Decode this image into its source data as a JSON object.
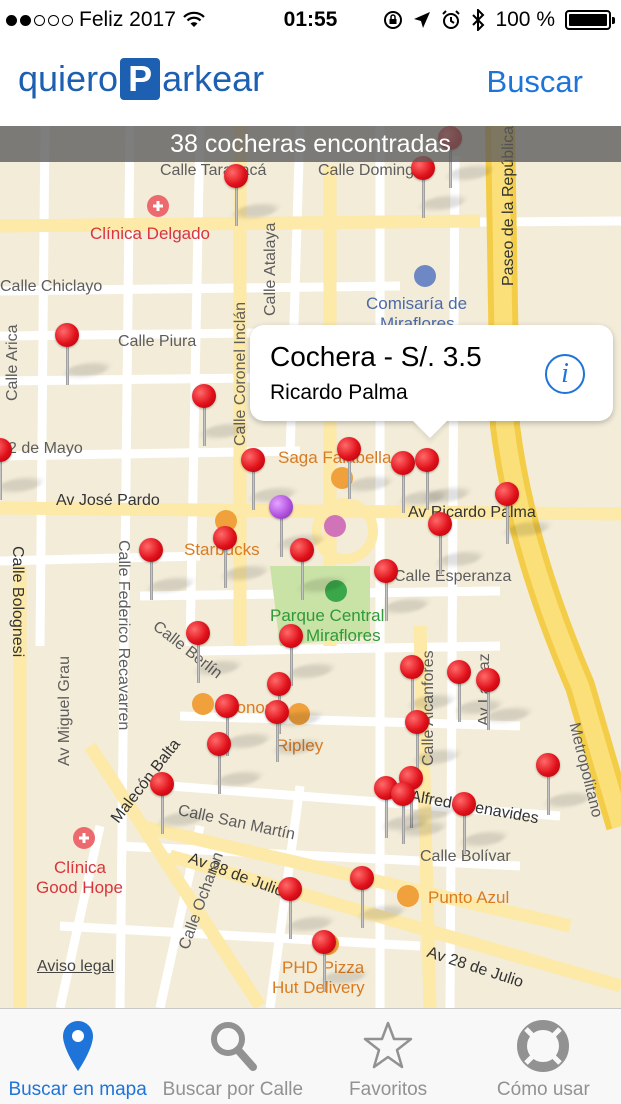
{
  "status_bar": {
    "carrier": "Feliz 2017",
    "time": "01:55",
    "battery": "100 %",
    "signal_icon": "signal-dots-icon",
    "wifi_icon": "wifi-icon",
    "lock_icon": "rotation-lock-icon",
    "location_icon": "location-arrow-icon",
    "alarm_icon": "alarm-icon",
    "bluetooth_icon": "bluetooth-icon"
  },
  "nav": {
    "logo_left": "quiero",
    "logo_p": "P",
    "logo_right": "arkear",
    "search_button": "Buscar"
  },
  "map": {
    "banner": "38 cocheras encontradas",
    "legal": "Aviso legal",
    "labels": {
      "calle_tarapaca": "Calle Tarapacá",
      "calle_domingo": "Calle Domingo",
      "clinica_delgado": "Clínica Delgado",
      "calle_chiclayo": "Calle Chiclayo",
      "calle_piura": "Calle Piura",
      "comisaria": "Comisaría de",
      "comisaria_2": "Miraflores",
      "paseo_republica": "Paseo de la República",
      "calle_arica": "Calle Arica",
      "calle_atalaya": "Calle Atalaya",
      "calle_coronel": "Calle Coronel Inclán",
      "dos_mayo": "2 de Mayo",
      "saga": "Saga Falabella",
      "av_jose_pardo": "Av José Pardo",
      "av_ricardo_palma": "Av Ricardo Palma",
      "starbucks": "Starbucks",
      "calle_esperanza": "Calle Esperanza",
      "calle_bolognesi": "Calle Bolognesi",
      "calle_federico": "Calle Federico Recavarren",
      "parque_1": "Parque Central",
      "parque_2": "Miraflores",
      "calle_berlin": "Calle Berlín",
      "av_miguel_grau": "Av Miguel Grau",
      "calle_alcanfores": "Calle Alcanfores",
      "av_la_paz": "Av La Paz",
      "tonos": "Tonos",
      "ripley": "Ripley",
      "malecon_balta": "Malecón Balta",
      "metropolitano": "Metropolitano",
      "alfredo_benavides": "Alfredo Benavides",
      "calle_san_martin": "Calle San Martín",
      "calle_bolivar": "Calle Bolívar",
      "clinica_gh_1": "Clínica",
      "clinica_gh_2": "Good Hope",
      "av_28_julio": "Av 28 de Julio",
      "punto_azul": "Punto Azul",
      "calle_ocharan": "Calle Ocharan",
      "phd_1": "PHD Pizza",
      "phd_2": "Hut Delivery",
      "av_28_julio_2": "Av 28 de Julio"
    },
    "callout": {
      "title": "Cochera - S/. 3.5",
      "subtitle": "Ricardo Palma",
      "info": "i"
    }
  },
  "tabbar": {
    "tabs": [
      {
        "label": "Buscar en mapa",
        "icon": "map-pin-icon",
        "active": true
      },
      {
        "label": "Buscar por Calle",
        "icon": "search-icon",
        "active": false
      },
      {
        "label": "Favoritos",
        "icon": "star-icon",
        "active": false
      },
      {
        "label": "Cómo usar",
        "icon": "lifebuoy-icon",
        "active": false
      }
    ]
  },
  "colors": {
    "accent": "#1e74d8",
    "brand": "#1d5fb1",
    "pin": "#e0111b",
    "pin_selected": "#b154e0"
  }
}
